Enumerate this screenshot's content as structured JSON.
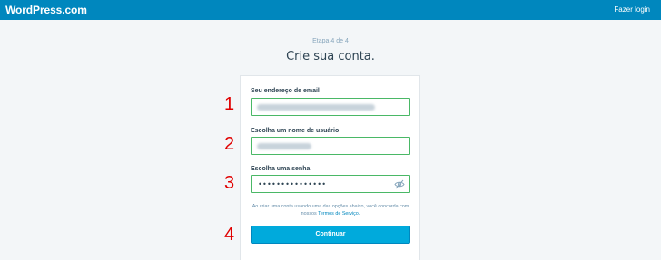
{
  "header": {
    "logo": "WordPress.com",
    "login_link": "Fazer login"
  },
  "step_text": "Etapa 4 de 4",
  "page_title": "Crie sua conta.",
  "fields": [
    {
      "label": "Seu endereço de email",
      "value": "fabiano@mestresdigitais.com.br",
      "blurred": true
    },
    {
      "label": "Escolha um nome de usuário",
      "value": "mestresdigitais",
      "blurred": true
    },
    {
      "label": "Escolha uma senha",
      "value": "•••••••••••••••",
      "blurred": false
    }
  ],
  "annotations": [
    "1",
    "2",
    "3",
    "4"
  ],
  "terms": {
    "text": "Ao criar uma conta usando uma das opções abaixo, você concorda com nossos",
    "link": "Termos de Serviço."
  },
  "continue_button": "Continuar",
  "colors": {
    "topbar": "#0087be",
    "button": "#00aadc",
    "field_border": "#4ab866",
    "annotation": "#e00000"
  }
}
